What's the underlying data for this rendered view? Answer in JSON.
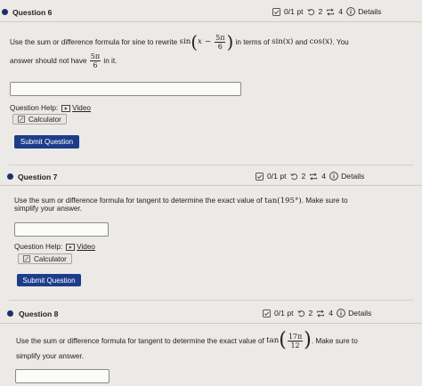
{
  "colors": {
    "accent": "#1d3d8a",
    "bullet": "#1d2f6e",
    "page_bg": "#eceae6"
  },
  "q6": {
    "title": "Question 6",
    "points": "0/1 pt",
    "tries": "2",
    "attempts": "4",
    "details": "Details",
    "text_before": "Use the sum or difference formula for sine to rewrite",
    "func": "sin",
    "var": "x",
    "minus": "−",
    "frac_num": "5π",
    "frac_den": "6",
    "text_middle": "in terms of",
    "sin_x": "sin(x)",
    "and_text": "and",
    "cos_x": "cos(x)",
    "text_you": ". You",
    "line2_start": "answer should not have",
    "line2_frac_num": "5π",
    "line2_frac_den": "6",
    "line2_end": "in it.",
    "help_label": "Question Help:",
    "video_label": "Video",
    "calculator_label": "Calculator",
    "submit_label": "Submit Question"
  },
  "q7": {
    "title": "Question 7",
    "points": "0/1 pt",
    "tries": "2",
    "attempts": "4",
    "details": "Details",
    "text_before": "Use the sum or difference formula for tangent to determine the exact value of",
    "expr": "tan(195°)",
    "text_after": ". Make sure to",
    "line2": "simplify your answer.",
    "help_label": "Question Help:",
    "video_label": "Video",
    "calculator_label": "Calculator",
    "submit_label": "Submit Question"
  },
  "q8": {
    "title": "Question 8",
    "points": "0/1 pt",
    "tries": "2",
    "attempts": "4",
    "details": "Details",
    "text_before": "Use the sum or difference formula for tangent to determine the exact value of",
    "func": "tan",
    "frac_num": "17π",
    "frac_den": "12",
    "text_after": ". Make sure to",
    "line2": "simplify your answer."
  }
}
